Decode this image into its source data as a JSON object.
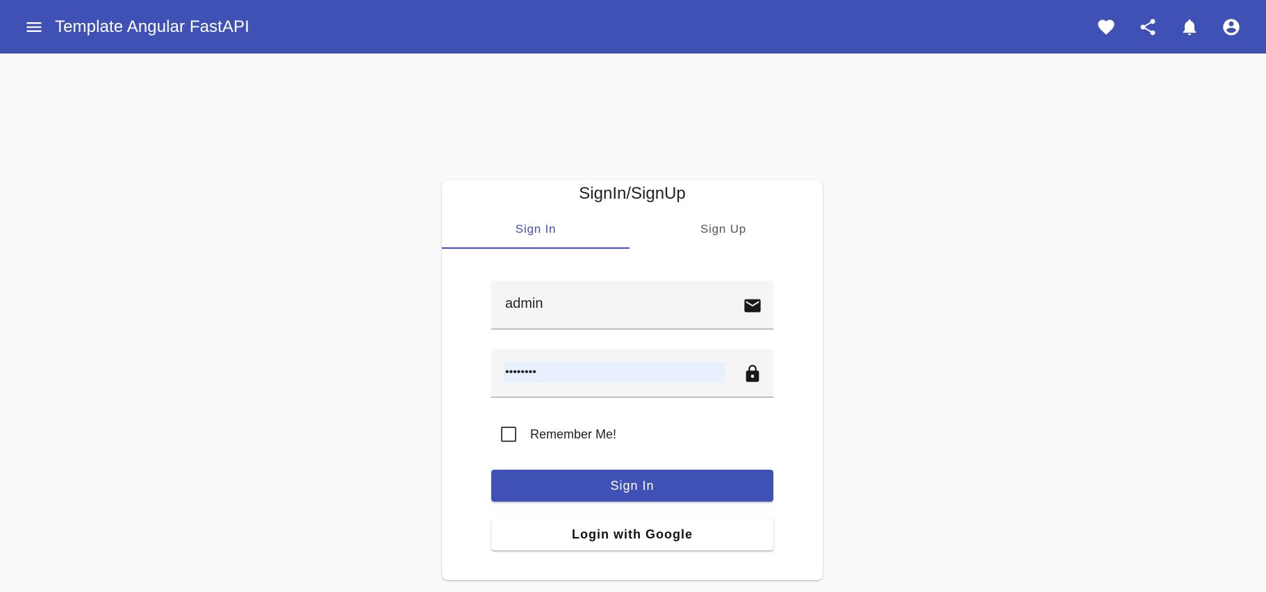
{
  "toolbar": {
    "title": "Template Angular FastAPI",
    "menu_icon": "menu-icon",
    "actions": [
      "favorite-icon",
      "share-icon",
      "notifications-icon",
      "account-circle-icon"
    ],
    "color": "#3f51b5"
  },
  "card": {
    "title": "SignIn/SignUp",
    "tabs": [
      {
        "label": "Sign In",
        "active": true
      },
      {
        "label": "Sign Up",
        "active": false
      }
    ],
    "email_field": {
      "value": "admin",
      "icon": "mail-icon"
    },
    "password_field": {
      "value": "••••••••",
      "icon": "lock-icon"
    },
    "remember_label": "Remember Me!",
    "remember_checked": false,
    "signin_button": "Sign In",
    "google_button": "Login with Google"
  }
}
